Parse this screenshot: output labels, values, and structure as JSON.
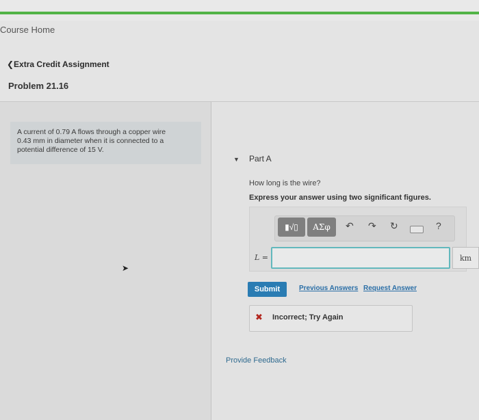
{
  "nav": {
    "course_home": "Course Home",
    "back_link": "❮Extra Credit Assignment"
  },
  "problem": {
    "title": "Problem 21.16",
    "statement_line1": "A current of 0.79 A flows through a copper wire",
    "statement_line2": "0.43 mm in diameter when it is connected to a",
    "statement_line3": "potential difference of 15 V."
  },
  "part": {
    "label": "Part A",
    "question": "How long is the wire?",
    "instruction": "Express your answer using two significant figures."
  },
  "toolbar": {
    "sqrt_label": "▮√▯",
    "greek_label": "ΑΣφ",
    "undo_icon": "undo-icon",
    "redo_icon": "redo-icon",
    "reset_icon": "reset-icon",
    "keyboard_icon": "keyboard-icon",
    "help_label": "?"
  },
  "answer": {
    "variable": "L =",
    "value": "",
    "unit": "km"
  },
  "actions": {
    "submit": "Submit",
    "previous_answers": "Previous Answers",
    "request_answer": "Request Answer"
  },
  "feedback": {
    "status": "Incorrect; Try Again",
    "provide_feedback": "Provide Feedback"
  },
  "colors": {
    "accent_green": "#52b447",
    "submit_blue": "#2a7cb3",
    "link_blue": "#2a6ea6",
    "error_red": "#b3261e",
    "input_border": "#62b8bd"
  }
}
